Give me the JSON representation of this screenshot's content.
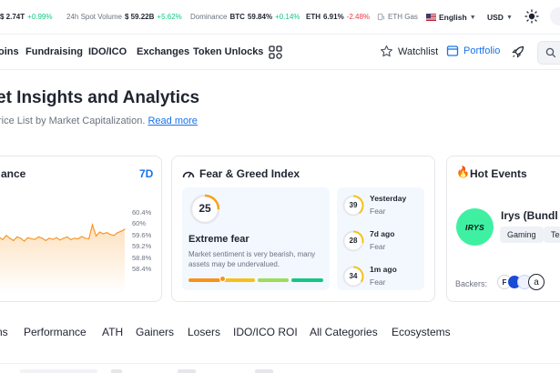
{
  "topbar": {
    "marketcap_value": "$ 2.74T",
    "marketcap_change": "+0.99%",
    "volume_label": "24h Spot Volume",
    "volume_value": "$ 59.22B",
    "volume_change": "+5.62%",
    "dominance_label": "Dominance",
    "btc_label": "BTC",
    "btc_value": "59.84%",
    "btc_change": "+0.14%",
    "eth_label": "ETH",
    "eth_value": "6.91%",
    "eth_change": "-2.48%",
    "gas_label": "ETH Gas",
    "language": "English",
    "currency": "USD",
    "colors": {
      "up": "#16c784",
      "down": "#ea3943"
    }
  },
  "nav": {
    "items": [
      "oins",
      "Fundraising",
      "IDO/ICO",
      "Exchanges",
      "Token Unlocks"
    ],
    "grid_icon": "grid-icon",
    "watchlist": "Watchlist",
    "portfolio": "Portfolio",
    "accent": "#1a73e8"
  },
  "header": {
    "title": "et Insights and Analytics",
    "subtitle": "rice List by Market Capitalization.",
    "read_more": "Read more"
  },
  "performance_card": {
    "title": "ance",
    "period": "7D",
    "y_ticks": [
      "60.4%",
      "60%",
      "59.6%",
      "59.2%",
      "58.8%",
      "58.4%"
    ],
    "chart_data": {
      "type": "area",
      "title": "",
      "ylim": [
        58.4,
        60.4
      ],
      "y": [
        59.55,
        59.45,
        59.6,
        59.5,
        59.42,
        59.55,
        59.5,
        59.4,
        59.52,
        59.48,
        59.46,
        59.55,
        59.5,
        59.42,
        59.5,
        59.46,
        59.52,
        59.44,
        59.5,
        59.55,
        59.45,
        59.5,
        59.48,
        59.56,
        59.5,
        59.48,
        59.98,
        59.58,
        59.72,
        59.66,
        59.7,
        59.64,
        59.6,
        59.7,
        59.75,
        59.82
      ],
      "color": "#f7931a"
    }
  },
  "fear_greed": {
    "title": "Fear & Greed Index",
    "current_value": "25",
    "current_label": "Extreme fear",
    "description": "Market sentiment is very bearish, many assets may be undervalued.",
    "history": [
      {
        "period": "Yesterday",
        "value": "39",
        "label": "Fear"
      },
      {
        "period": "7d ago",
        "value": "28",
        "label": "Fear"
      },
      {
        "period": "1m ago",
        "value": "34",
        "label": "Fear"
      }
    ],
    "scale_colors": [
      "#f7931a",
      "#f7c11a",
      "#9ddc5a",
      "#16c784"
    ],
    "gauge_color": "#f7a21a"
  },
  "hot_events": {
    "title": "Hot Events",
    "logo_text": "IRYS",
    "project_name": "Irys (Bundl",
    "tags": [
      "Gaming",
      "Tes"
    ],
    "backers_label": "Backers:",
    "logo_color": "#3ff0a2"
  },
  "category_tabs": [
    "ns",
    "Performance",
    "ATH",
    "Gainers",
    "Losers",
    "IDO/ICO ROI",
    "All Categories",
    "Ecosystems"
  ]
}
